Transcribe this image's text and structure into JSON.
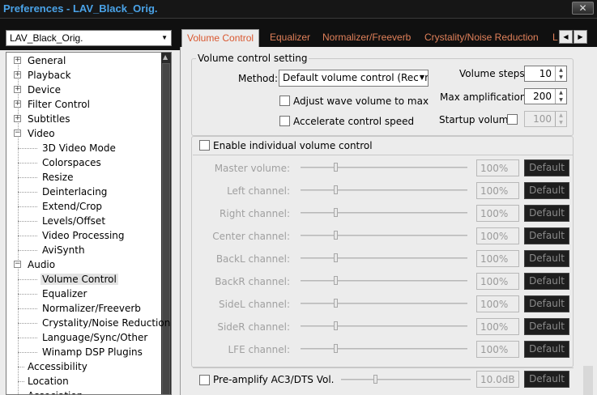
{
  "window": {
    "title": "Preferences - LAV_Black_Orig.",
    "close_glyph": "✕"
  },
  "preset": {
    "value": "LAV_Black_Orig.",
    "arrow": "▼"
  },
  "tree": {
    "items": [
      {
        "label": "General",
        "expander": "+"
      },
      {
        "label": "Playback",
        "expander": "+"
      },
      {
        "label": "Device",
        "expander": "+"
      },
      {
        "label": "Filter Control",
        "expander": "+"
      },
      {
        "label": "Subtitles",
        "expander": "+"
      },
      {
        "label": "Video",
        "expander": "−"
      },
      {
        "label": "3D Video Mode"
      },
      {
        "label": "Colorspaces"
      },
      {
        "label": "Resize"
      },
      {
        "label": "Deinterlacing"
      },
      {
        "label": "Extend/Crop"
      },
      {
        "label": "Levels/Offset"
      },
      {
        "label": "Video Processing"
      },
      {
        "label": "AviSynth"
      },
      {
        "label": "Audio",
        "expander": "−"
      },
      {
        "label": "Volume Control",
        "selected": true
      },
      {
        "label": "Equalizer"
      },
      {
        "label": "Normalizer/Freeverb"
      },
      {
        "label": "Crystality/Noise Reduction"
      },
      {
        "label": "Language/Sync/Other"
      },
      {
        "label": "Winamp DSP Plugins"
      },
      {
        "label": "Accessibility"
      },
      {
        "label": "Location"
      },
      {
        "label": "Association"
      }
    ]
  },
  "tabs": [
    {
      "label": "Volume Control",
      "active": true
    },
    {
      "label": "Equalizer"
    },
    {
      "label": "Normalizer/Freeverb"
    },
    {
      "label": "Crystality/Noise Reduction"
    },
    {
      "label": "L"
    }
  ],
  "tab_nav": {
    "prev": "◀",
    "next": "▶"
  },
  "volume_control": {
    "group_title": "Volume control setting",
    "method_label": "Method:",
    "method_value": "Default volume control (Recor",
    "method_arrow": "▼",
    "adjust_wave_label": "Adjust wave volume to max",
    "adjust_wave_checked": false,
    "accelerate_label": "Accelerate control speed",
    "accelerate_checked": false,
    "volume_steps_label": "Volume steps:",
    "volume_steps_value": "10",
    "max_amp_label": "Max amplification:",
    "max_amp_value": "200",
    "startup_label": "Startup volume",
    "startup_checked": false,
    "startup_value": "100",
    "spin_up": "▲",
    "spin_down": "▼"
  },
  "individual": {
    "enable_label": "Enable individual volume control",
    "enable_checked": false,
    "default_label": "Default",
    "channels": [
      {
        "label": "Master volume:",
        "value": "100%",
        "level": 0.2
      },
      {
        "label": "Left channel:",
        "value": "100%",
        "level": 0.2
      },
      {
        "label": "Right channel:",
        "value": "100%",
        "level": 0.2
      },
      {
        "label": "Center channel:",
        "value": "100%",
        "level": 0.2
      },
      {
        "label": "BackL channel:",
        "value": "100%",
        "level": 0.2
      },
      {
        "label": "BackR channel:",
        "value": "100%",
        "level": 0.2
      },
      {
        "label": "SideL channel:",
        "value": "100%",
        "level": 0.2
      },
      {
        "label": "SideR channel:",
        "value": "100%",
        "level": 0.2
      },
      {
        "label": "LFE channel:",
        "value": "100%",
        "level": 0.2
      }
    ]
  },
  "preamp": {
    "label": "Pre-amplify AC3/DTS Vol.",
    "checked": false,
    "value": "10.0dB",
    "default_label": "Default",
    "level": 0.25
  }
}
